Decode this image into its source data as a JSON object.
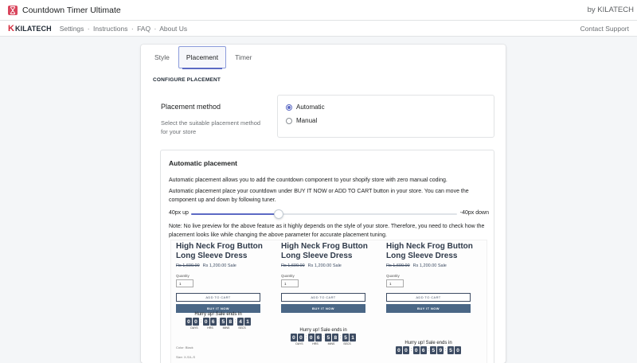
{
  "topbar": {
    "title": "Countdown Timer Ultimate",
    "by": "by KILATECH",
    "icon": "hourglass-icon"
  },
  "navbar": {
    "brand_k": "K",
    "brand_rest": "KILATECH",
    "links": [
      "Settings",
      "Instructions",
      "FAQ",
      "About Us"
    ],
    "separator": "·",
    "contact": "Contact Support"
  },
  "tabs": [
    {
      "label": "Style",
      "active": false
    },
    {
      "label": "Placement",
      "active": true
    },
    {
      "label": "Timer",
      "active": false
    }
  ],
  "section_title": "CONFIGURE PLACEMENT",
  "placement_method": {
    "title": "Placement method",
    "description": "Select the suitable placement method for your store",
    "options": [
      {
        "label": "Automatic",
        "checked": true
      },
      {
        "label": "Manual",
        "checked": false
      }
    ]
  },
  "automatic_placement": {
    "title": "Automatic placement",
    "text1": "Automatic placement allows you to add the countdown component to your shopify store with zero manual coding.",
    "text2": "Automatic placement place your countdown under BUY IT NOW or ADD TO CART button in your store. You can move the component up and down by following tuner.",
    "slider": {
      "left_label": "40px up",
      "right_label": "-40px down",
      "value_fraction": 0.33
    },
    "note": "Note: No live preview for the above feature as it highly depends on the style of your store. Therefore, you need to check how the placement looks like while changing the above parameter for accurate placement tuning."
  },
  "preview": {
    "product_title": "High Neck Frog Button Long Sleeve Dress",
    "old_price": "Rs 1,600.00",
    "new_price": "Rs 1,200.00 Sale",
    "quantity_label": "Quantity",
    "quantity_value": "1",
    "add_to_cart": "ADD TO CART",
    "buy_now": "BUY IT NOW",
    "timer_label": "Hurry up! Sale ends in",
    "units": [
      "DAYS",
      "HRS",
      "MINS",
      "SECS"
    ],
    "meta_color": "Color: Black",
    "meta_size": "Size: X-S/L-S",
    "columns": [
      {
        "digits": [
          "0",
          "0",
          "0",
          "6",
          "5",
          "8",
          "4",
          "1"
        ]
      },
      {
        "digits": [
          "0",
          "0",
          "0",
          "6",
          "5",
          "8",
          "5",
          "1"
        ]
      },
      {
        "digits": [
          "0",
          "0",
          "0",
          "6",
          "5",
          "9",
          "5",
          "0"
        ]
      }
    ]
  }
}
